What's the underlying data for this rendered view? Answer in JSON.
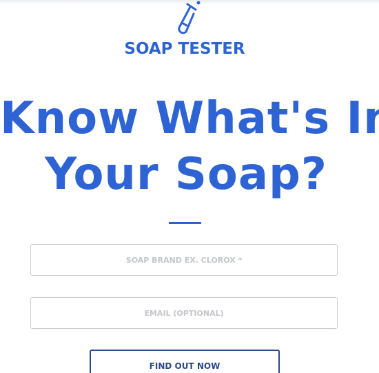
{
  "brand": {
    "logo_icon": "test-tube-icon",
    "name": "SOAP TESTER",
    "color": "#2e63d4"
  },
  "hero": {
    "headline_line1": "Know What's In",
    "headline_line2": "Your Soap?"
  },
  "form": {
    "brand_field": {
      "value": "",
      "placeholder": "SOAP BRAND EX. CLOROX *"
    },
    "email_field": {
      "value": "",
      "placeholder": "EMAIL (OPTIONAL)"
    },
    "submit_label": "FIND OUT NOW"
  },
  "colors": {
    "accent": "#2e63d4",
    "button_border": "#2b4a87",
    "field_border": "#c9cdd3",
    "placeholder": "#c3c5c9"
  }
}
